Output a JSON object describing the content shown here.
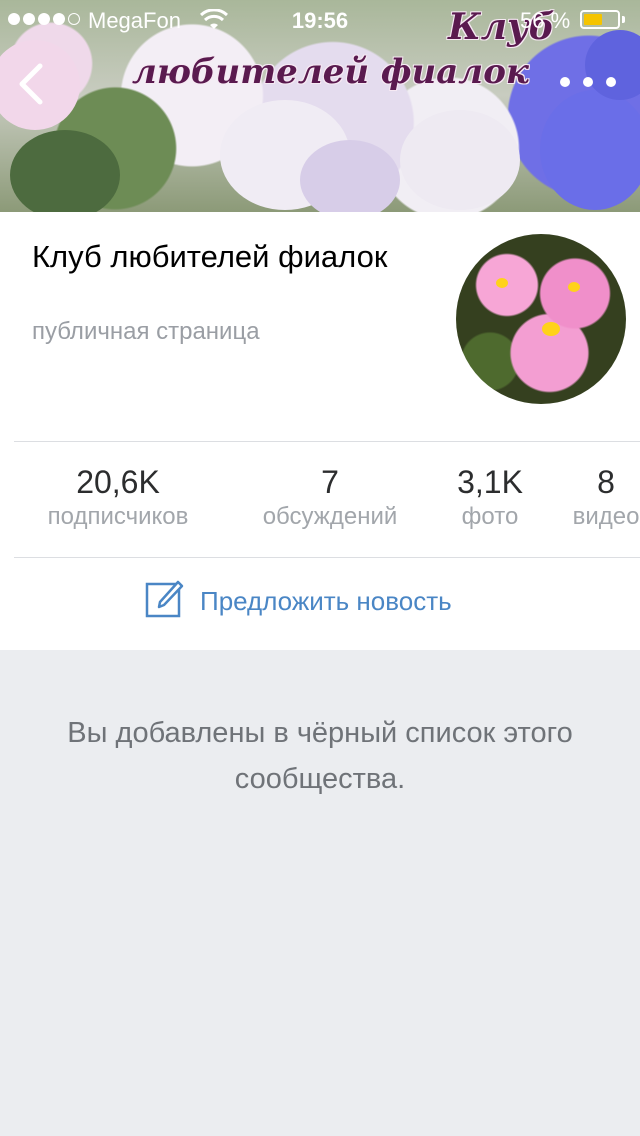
{
  "status_bar": {
    "carrier": "MegaFon",
    "time": "19:56",
    "battery_percent": "56 %",
    "battery_level": 0.56,
    "signal_bars": 4
  },
  "cover": {
    "title_line1": "Клуб",
    "title_line2": "любителей фиалок"
  },
  "nav": {
    "back_icon": "chevron-left-icon",
    "more_icon": "more-dots-icon"
  },
  "group": {
    "name": "Клуб любителей фиалок",
    "type": "публичная страница"
  },
  "stats": [
    {
      "value": "20,6K",
      "label": "подписчиков"
    },
    {
      "value": "7",
      "label": "обсуждений"
    },
    {
      "value": "3,1K",
      "label": "фото"
    },
    {
      "value": "8",
      "label": "видео"
    }
  ],
  "suggest_news": {
    "label": "Предложить новость",
    "icon": "edit-icon"
  },
  "message": "Вы добавлены в чёрный список этого сообщества.",
  "colors": {
    "accent": "#4a86c5",
    "background": "#ebedf0",
    "battery": "#f5c400"
  }
}
